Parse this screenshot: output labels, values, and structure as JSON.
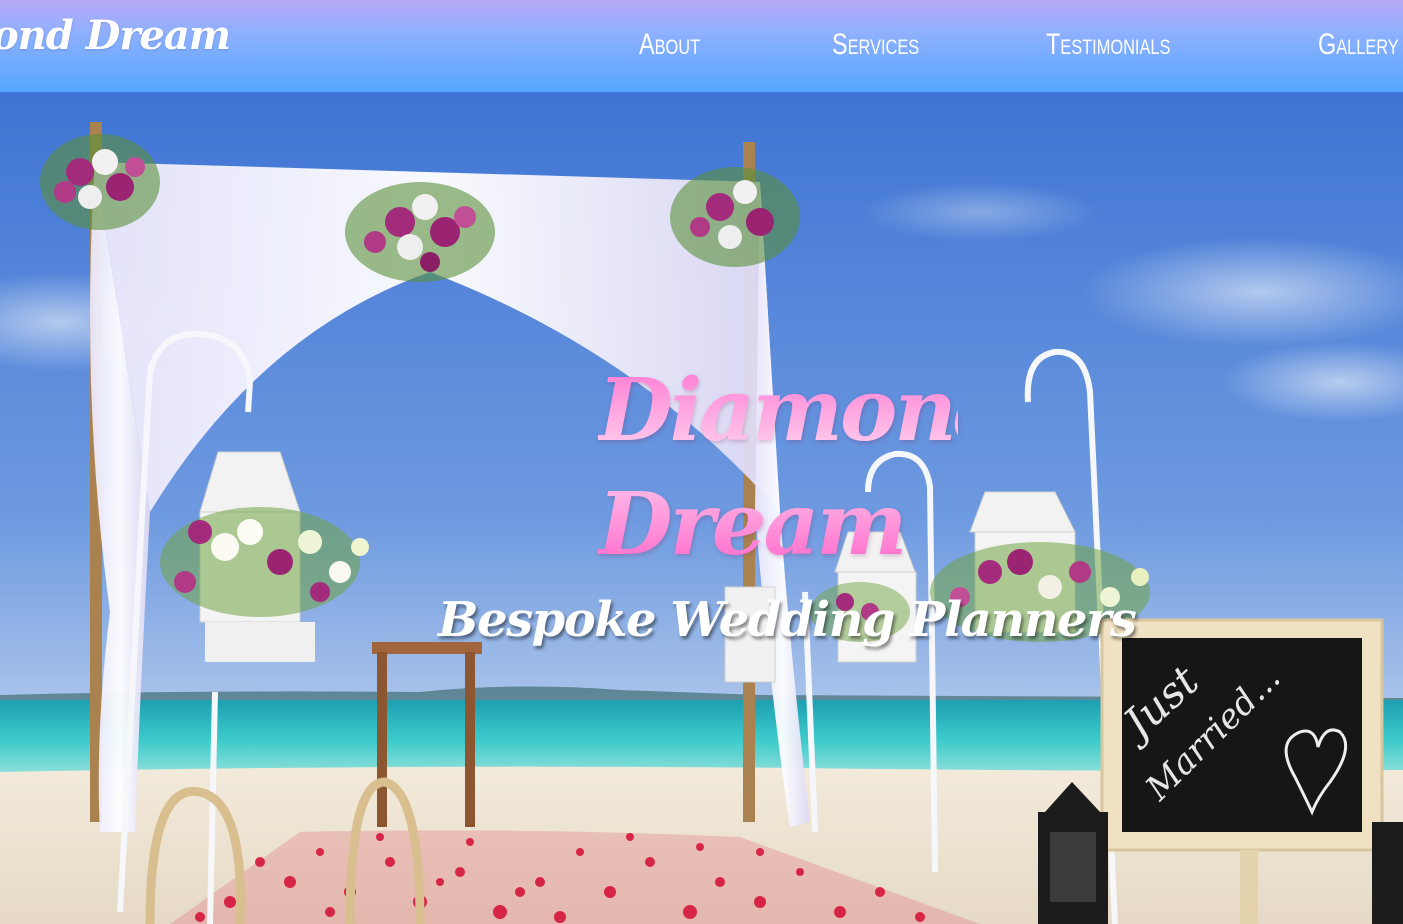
{
  "navbar": {
    "brand": "ond Dream",
    "links": [
      {
        "label": "About"
      },
      {
        "label": "Services"
      },
      {
        "label": "Testimonials"
      },
      {
        "label": "Gallery"
      }
    ]
  },
  "hero": {
    "title": "Diamond Dream",
    "subtitle": "Bespoke Wedding Planners",
    "chalkboard_text": "Just Married...",
    "background_image": "beach-wedding-arch-photo"
  },
  "colors": {
    "nav_gradient_top": "#b8a8f5",
    "nav_gradient_bottom": "#55a6ff",
    "title_pink": "#f067c4",
    "subtitle_white": "#ffffff",
    "sky_blue": "#4f86d8",
    "sea_turquoise": "#3cc3c7",
    "sand": "#f3ebdc",
    "petal_red": "#d81b3c"
  }
}
